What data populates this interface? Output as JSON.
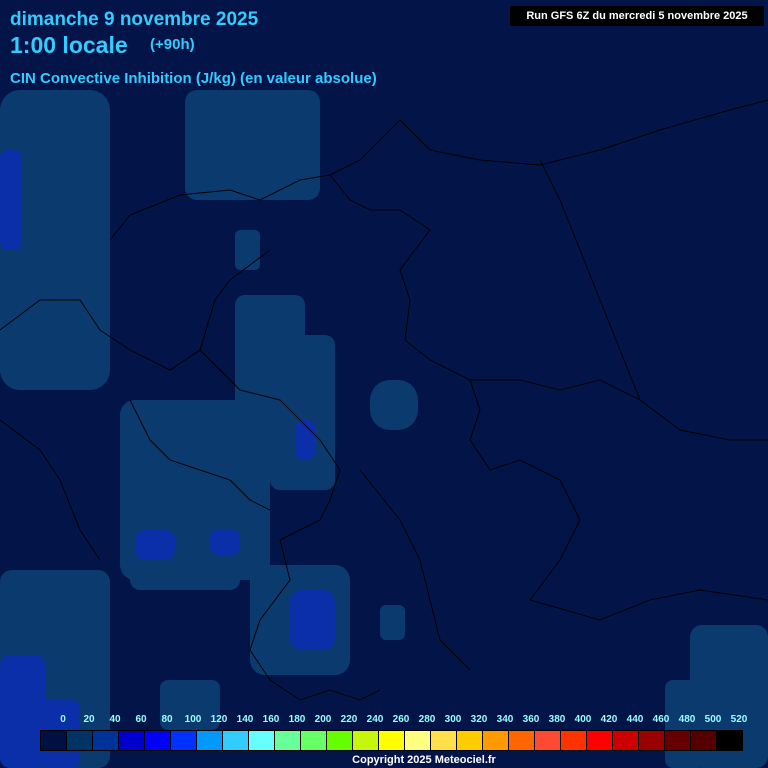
{
  "header": {
    "date": "dimanche 9 novembre 2025",
    "local_time": "1:00 locale",
    "lead": "(+90h)",
    "parameter": "CIN Convective Inhibition (J/kg) (en valeur absolue)",
    "run": "Run GFS 6Z du mercredi 5 novembre 2025"
  },
  "legend": {
    "labels": [
      "0",
      "20",
      "40",
      "60",
      "80",
      "100",
      "120",
      "140",
      "160",
      "180",
      "200",
      "220",
      "240",
      "260",
      "280",
      "300",
      "320",
      "340",
      "360",
      "380",
      "400",
      "420",
      "440",
      "460",
      "480",
      "500",
      "520"
    ],
    "colors": [
      "#001040",
      "#003366",
      "#003399",
      "#0000cc",
      "#0000ff",
      "#0033ff",
      "#0099ff",
      "#33ccff",
      "#66ffff",
      "#66ff99",
      "#66ff66",
      "#66ff00",
      "#c6f70a",
      "#ffff00",
      "#ffff80",
      "#ffe04a",
      "#ffcc00",
      "#ff9900",
      "#ff6600",
      "#ff4a33",
      "#ff3300",
      "#ff0000",
      "#cc0000",
      "#990000",
      "#660000",
      "#550000",
      "#000000"
    ]
  },
  "footer": {
    "copyright": "Copyright 2025 Meteociel.fr"
  }
}
